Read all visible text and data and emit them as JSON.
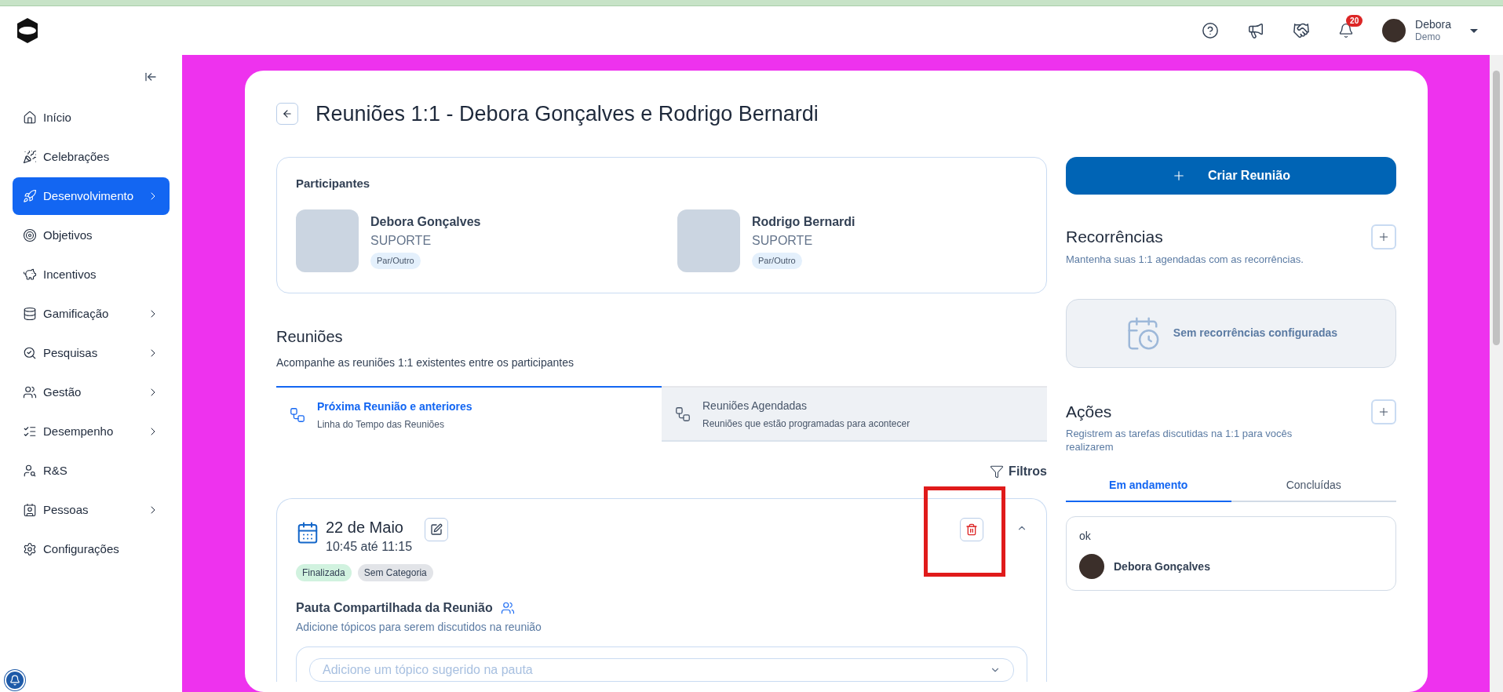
{
  "topbar": {
    "notifications_badge": "20",
    "user": {
      "name": "Debora",
      "subtitle": "Demo"
    }
  },
  "sidebar": {
    "items": [
      {
        "label": "Início",
        "selected": false,
        "has_submenu": false
      },
      {
        "label": "Celebrações",
        "selected": false,
        "has_submenu": false
      },
      {
        "label": "Desenvolvimento",
        "selected": true,
        "has_submenu": true
      },
      {
        "label": "Objetivos",
        "selected": false,
        "has_submenu": false
      },
      {
        "label": "Incentivos",
        "selected": false,
        "has_submenu": false
      },
      {
        "label": "Gamificação",
        "selected": false,
        "has_submenu": true
      },
      {
        "label": "Pesquisas",
        "selected": false,
        "has_submenu": true
      },
      {
        "label": "Gestão",
        "selected": false,
        "has_submenu": true
      },
      {
        "label": "Desempenho",
        "selected": false,
        "has_submenu": true
      },
      {
        "label": "R&S",
        "selected": false,
        "has_submenu": false
      },
      {
        "label": "Pessoas",
        "selected": false,
        "has_submenu": true
      },
      {
        "label": "Configurações",
        "selected": false,
        "has_submenu": false
      }
    ]
  },
  "page": {
    "title": "Reuniões 1:1 - Debora Gonçalves e Rodrigo Bernardi"
  },
  "participants": {
    "title": "Participantes",
    "people": [
      {
        "name": "Debora Gonçalves",
        "team": "SUPORTE",
        "tag": "Par/Outro"
      },
      {
        "name": "Rodrigo Bernardi",
        "team": "SUPORTE",
        "tag": "Par/Outro"
      }
    ]
  },
  "meetings": {
    "title": "Reuniões",
    "subtitle": "Acompanhe as reuniões 1:1 existentes entre os participantes",
    "tabs": [
      {
        "label": "Próxima Reunião e anteriores",
        "sublabel": "Linha do Tempo das Reuniões",
        "selected": true
      },
      {
        "label": "Reuniões Agendadas",
        "sublabel": "Reuniões que estão programadas para acontecer",
        "selected": false
      }
    ],
    "filter_label": "Filtros",
    "meeting": {
      "date": "22 de Maio",
      "time": "10:45 até 11:15",
      "expanded": true,
      "tags": [
        {
          "label": "Finalizada",
          "color": "#d1f2df"
        },
        {
          "label": "Sem Categoria",
          "color": "#e2e4e8"
        }
      ],
      "agenda_title": "Pauta Compartilhada da Reunião",
      "agenda_subtitle": "Adicione tópicos para serem discutidos na reunião",
      "topic_placeholder": "Adicione um tópico sugerido na pauta"
    }
  },
  "right": {
    "create_button": "Criar Reunião",
    "recurrences": {
      "title": "Recorrências",
      "subtitle": "Mantenha suas 1:1 agendadas com as recorrências.",
      "empty": "Sem recorrências configuradas"
    },
    "actions": {
      "title": "Ações",
      "subtitle": "Registrem as tarefas discutidas na 1:1 para vocês realizarem",
      "tabs": [
        {
          "label": "Em andamento",
          "selected": true
        },
        {
          "label": "Concluídas",
          "selected": false
        }
      ],
      "items": [
        {
          "text": "ok",
          "owner": "Debora Gonçalves"
        }
      ]
    }
  }
}
